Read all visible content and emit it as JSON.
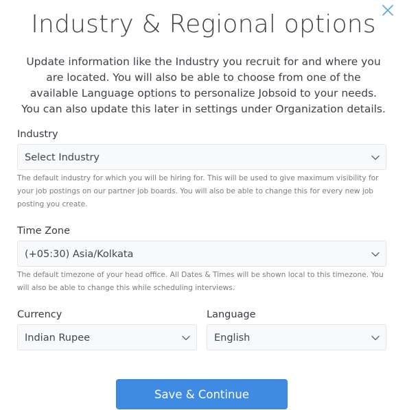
{
  "dialog": {
    "title": "Industry & Regional options",
    "intro": "Update information like the Industry you recruit for and where you are located. You will also be able to choose from one of the available Language options to personalize Jobsoid to your needs. You can also update this later in settings under Organization details."
  },
  "industry": {
    "label": "Industry",
    "value": "Select Industry",
    "help": "The default industry for which you will be hiring for. This will be used to give maximum visibility for your job postings on our partner job boards. You will also be able to change this for every new job posting you create."
  },
  "timezone": {
    "label": "Time Zone",
    "value": "(+05:30) Asia/Kolkata",
    "help": "The default timezone of your head office. All Dates & Times will be shown local to this timezone. You will also be able to change this while scheduling interviews."
  },
  "currency": {
    "label": "Currency",
    "value": "Indian Rupee"
  },
  "language": {
    "label": "Language",
    "value": "English"
  },
  "actions": {
    "save_label": "Save & Continue"
  },
  "colors": {
    "primary_button": "#3f8be3",
    "close_icon": "#5aa6d9",
    "field_background": "#f7f9fb",
    "field_border": "#e2e6ea"
  },
  "icons": {
    "close": "close-icon",
    "dropdown": "chevron-down-icon"
  }
}
